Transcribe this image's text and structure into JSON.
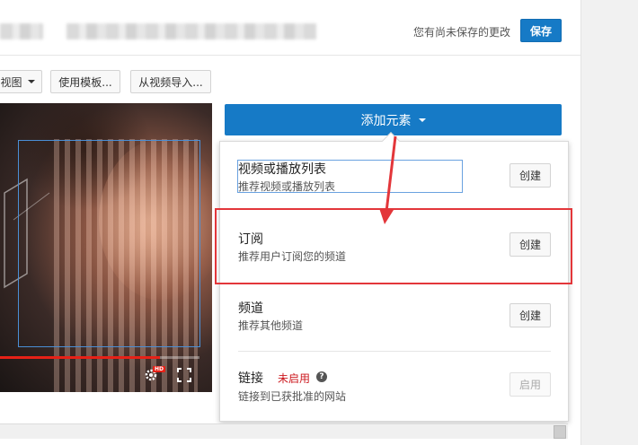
{
  "header": {
    "unsaved_text": "您有尚未保存的更改",
    "save_label": "保存"
  },
  "toolbar": {
    "view_label": "视图",
    "use_template_label": "使用模板...",
    "import_label": "从视频导入..."
  },
  "video": {
    "progress_fraction": 0.8,
    "progress_color": "#e62117",
    "hd_badge": "HD",
    "icons": [
      "settings-icon",
      "fullscreen-icon"
    ]
  },
  "add_element": {
    "label": "添加元素",
    "items": [
      {
        "title": "视频或播放列表",
        "desc": "推荐视频或播放列表",
        "button": "创建"
      },
      {
        "title": "订阅",
        "desc": "推荐用户订阅您的频道",
        "button": "创建"
      },
      {
        "title": "频道",
        "desc": "推荐其他频道",
        "button": "创建"
      },
      {
        "title": "链接",
        "desc": "链接到已获批准的网站",
        "button": "启用",
        "status": "未启用",
        "help_symbol": "?"
      }
    ]
  },
  "colors": {
    "accent": "#167ac6",
    "highlight_red": "#e3363a",
    "status_red": "#cc181e"
  }
}
